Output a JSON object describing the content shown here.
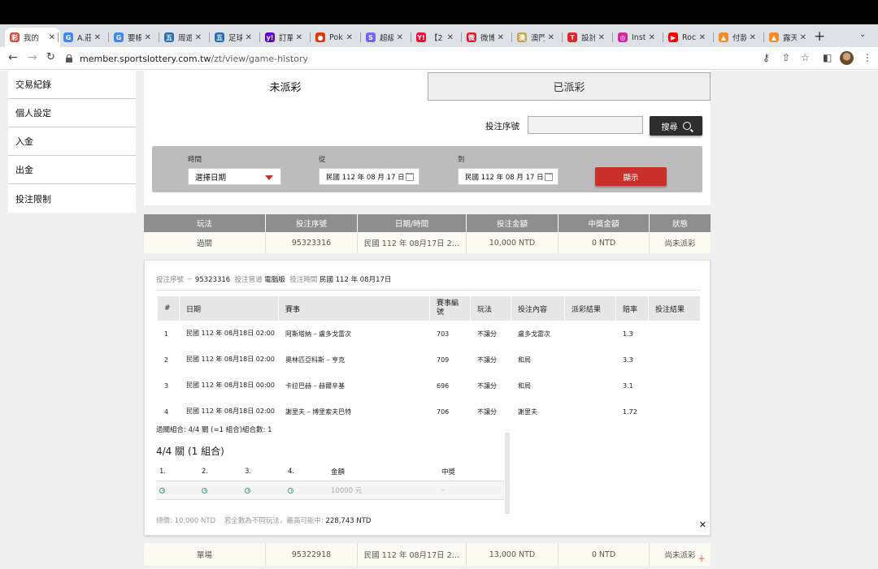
{
  "browser": {
    "tabs": [
      {
        "label": "我的",
        "color": "#d84b3c",
        "glyph": "彩"
      },
      {
        "label": "A.莊",
        "color": "#4285f4",
        "glyph": "G"
      },
      {
        "label": "要帳",
        "color": "#4285f4",
        "glyph": "G"
      },
      {
        "label": "周遊",
        "color": "#2b6cb0",
        "glyph": "五"
      },
      {
        "label": "足球",
        "color": "#2b6cb0",
        "glyph": "五"
      },
      {
        "label": "訂單",
        "color": "#5f01d1",
        "glyph": "y!"
      },
      {
        "label": "Poke",
        "color": "#e3350d",
        "glyph": "●"
      },
      {
        "label": "超級",
        "color": "#7b61ff",
        "glyph": "S"
      },
      {
        "label": "【2",
        "color": "#ff0033",
        "glyph": "Y!"
      },
      {
        "label": "微博",
        "color": "#e6162d",
        "glyph": "微"
      },
      {
        "label": "澳門",
        "color": "#c7a252",
        "glyph": "澳"
      },
      {
        "label": "設計",
        "color": "#e82127",
        "glyph": "T"
      },
      {
        "label": "Insta",
        "color": "#d6249f",
        "glyph": "◎"
      },
      {
        "label": "Roc",
        "color": "#ff0000",
        "glyph": "▶"
      },
      {
        "label": "付款",
        "color": "#f28c28",
        "glyph": "▲"
      },
      {
        "label": "露天",
        "color": "#f28c28",
        "glyph": "▲"
      }
    ],
    "url_host": "member.sportslottery.com.tw",
    "url_path": "/zt/view/game-history"
  },
  "sidebar": {
    "items": [
      "交易紀錄",
      "個人設定",
      "入金",
      "出金",
      "投注限制"
    ]
  },
  "tabs": {
    "open": "未派彩",
    "settled": "已派彩"
  },
  "search": {
    "label": "投注序號",
    "value": "",
    "button": "搜尋"
  },
  "filter": {
    "time_label": "時間",
    "time_value": "選擇日期",
    "from_label": "從",
    "from_value": "民國 112 年 08 月 17 日",
    "to_label": "到",
    "to_value": "民國 112 年 08 月 17 日",
    "show_button": "顯示"
  },
  "result_table": {
    "headers": [
      "玩法",
      "投注序號",
      "日期/時間",
      "投注金額",
      "中獎金額",
      "狀態"
    ],
    "rows": [
      [
        "過關",
        "95323316",
        "民國 112 年 08月17日 2…",
        "10,000 NTD",
        "0 NTD",
        "尚未派彩"
      ],
      [
        "單場",
        "95322918",
        "民國 112 年 08月17日 2…",
        "13,000 NTD",
        "0 NTD",
        "尚未派彩"
      ]
    ]
  },
  "detail": {
    "meta": {
      "serial_label": "投注序號 －",
      "serial_value": "95323316",
      "channel_label": "投注管道",
      "channel_value": "電腦版",
      "time_label": "投注時間",
      "time_value": "民國 112 年 08月17日"
    },
    "headers": [
      "#",
      "日期",
      "賽事",
      "賽事編號",
      "玩法",
      "投注內容",
      "派彩結果",
      "賠率",
      "投注結果"
    ],
    "rows": [
      {
        "no": "1",
        "date": "民國 112 年 08月18日 02:00",
        "match": "阿斯塔納 – 盧多戈雷次",
        "code": "703",
        "type": "不讓分",
        "pick": "盧多戈雷次",
        "result": "",
        "odds": "1.3",
        "outcome": ""
      },
      {
        "no": "2",
        "date": "民國 112 年 08月18日 02:00",
        "match": "奧林匹亞科斯 – 亨克",
        "code": "709",
        "type": "不讓分",
        "pick": "和局",
        "result": "",
        "odds": "3.3",
        "outcome": ""
      },
      {
        "no": "3",
        "date": "民國 112 年 08月18日 00:00",
        "match": "卡拉巴赫 – 赫爾辛基",
        "code": "696",
        "type": "不讓分",
        "pick": "和局",
        "result": "",
        "odds": "3.1",
        "outcome": ""
      },
      {
        "no": "4",
        "date": "民國 112 年 08月18日 02:00",
        "match": "謝里夫 – 博里索夫巴特",
        "code": "706",
        "type": "不讓分",
        "pick": "謝里夫",
        "result": "",
        "odds": "1.72",
        "outcome": ""
      }
    ],
    "combo_summary": "過關組合: 4/4 關 (=1 組合)組合數: 1",
    "combo_title": "4/4 關 (1 組合)",
    "combo_headers": [
      "1.",
      "2.",
      "3.",
      "4.",
      "金額",
      "中獎"
    ],
    "combo_amount": "10000 元",
    "combo_win": "–",
    "total_label": "總價: 10,000 NTD",
    "max_label": "若全數為不同玩法，最高可能中:",
    "max_value": "228,743 NTD"
  }
}
